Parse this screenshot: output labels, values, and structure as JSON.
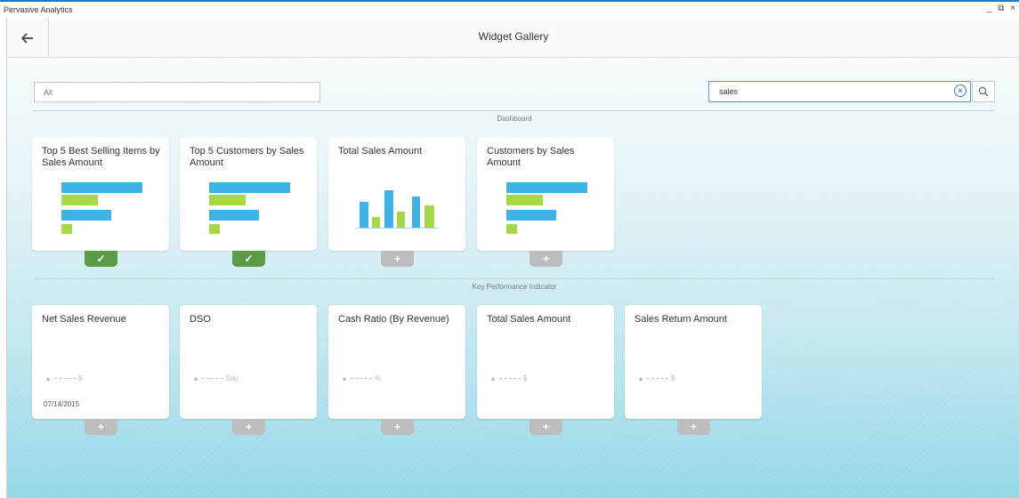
{
  "window": {
    "app_title": "Pervasive Analytics",
    "controls": "_ ⧉ ×"
  },
  "header": {
    "title": "Widget Gallery",
    "back_icon": "arrow-left-icon"
  },
  "filters": {
    "category_value": "All",
    "search_value": "sales",
    "clear_icon": "clear-circle-icon",
    "search_icon": "magnifier-icon"
  },
  "colors": {
    "bar_blue": "#3fb3e6",
    "bar_green": "#a7d84a",
    "added_green": "#5c9b45",
    "add_gray": "#bdbdbd"
  },
  "sections": [
    {
      "title": "Dashboard",
      "tiles": [
        {
          "title": "Top 5 Best Selling Items by Sales Amount",
          "chart": "horizontal-bar",
          "action": "added",
          "action_symbol": "✓"
        },
        {
          "title": "Top 5 Customers by Sales Amount",
          "chart": "horizontal-bar",
          "action": "added",
          "action_symbol": "✓"
        },
        {
          "title": "Total Sales Amount",
          "chart": "vertical-bar",
          "action": "add",
          "action_symbol": "+"
        },
        {
          "title": "Customers by Sales Amount",
          "chart": "horizontal-bar",
          "action": "add",
          "action_symbol": "+"
        }
      ]
    },
    {
      "title": "Key Performance Indicator",
      "tiles": [
        {
          "title": "Net Sales Revenue",
          "unit": "$",
          "date": "07/14/2015",
          "action": "add",
          "action_symbol": "+"
        },
        {
          "title": "DSO",
          "unit": "Day",
          "action": "add",
          "action_symbol": "+"
        },
        {
          "title": "Cash Ratio (By Revenue)",
          "unit": "%",
          "action": "add",
          "action_symbol": "+"
        },
        {
          "title": "Total Sales Amount",
          "unit": "$",
          "action": "add",
          "action_symbol": "+"
        },
        {
          "title": "Sales Return Amount",
          "unit": "$",
          "action": "add",
          "action_symbol": "+"
        }
      ]
    }
  ]
}
